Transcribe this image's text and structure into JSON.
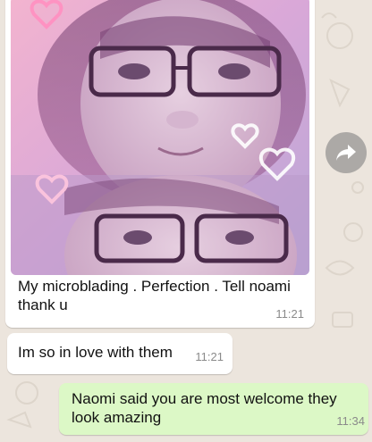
{
  "messages": [
    {
      "type": "image",
      "direction": "incoming",
      "caption": "My microblading . Perfection . Tell noami thank u",
      "time": "11:21"
    },
    {
      "type": "text",
      "direction": "incoming",
      "text": "Im so in love with them",
      "time": "11:21"
    },
    {
      "type": "text",
      "direction": "outgoing",
      "text": "Naomi said you are most welcome they look amazing",
      "time": "11:34"
    }
  ],
  "forward_button": {
    "icon": "forward-arrow-icon"
  },
  "colors": {
    "chat_background": "#ece5dd",
    "incoming_bubble": "#ffffff",
    "outgoing_bubble": "#dcf8c6",
    "timestamp": "#8a8a8a"
  }
}
